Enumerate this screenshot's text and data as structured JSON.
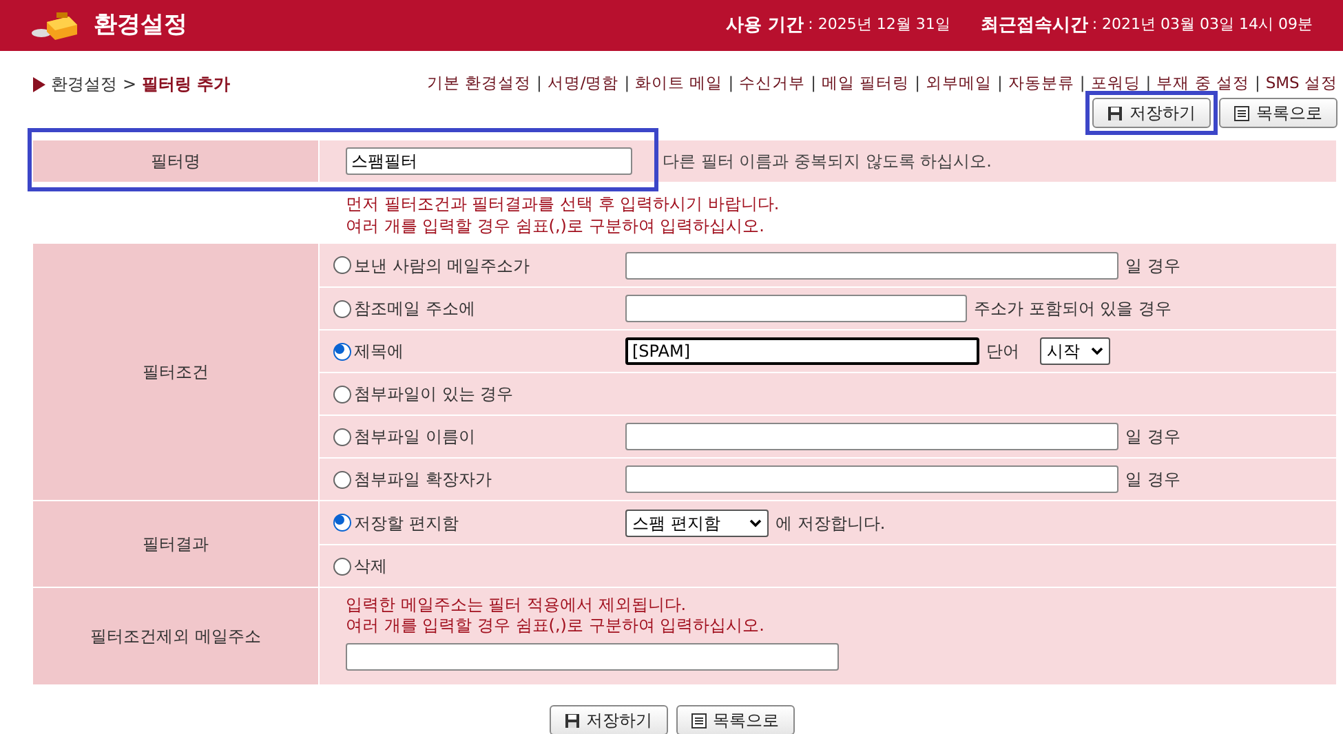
{
  "header": {
    "title": "환경설정",
    "period_label": "사용 기간",
    "period_value": ": 2025년 12월 31일",
    "login_label": "최근접속시간",
    "login_value": ": 2021년 03월 03일 14시 09분"
  },
  "breadcrumb": {
    "root": "환경설정",
    "separator": ">",
    "current": "필터링 추가"
  },
  "nav": [
    {
      "kind": "link",
      "label": "기본 환경설정"
    },
    {
      "kind": "separator",
      "label": "|"
    },
    {
      "kind": "link",
      "label": "서명/명함"
    },
    {
      "kind": "separator",
      "label": "|"
    },
    {
      "kind": "link",
      "label": "화이트 메일"
    },
    {
      "kind": "separator",
      "label": "|"
    },
    {
      "kind": "link",
      "label": "수신거부"
    },
    {
      "kind": "separator",
      "label": "|"
    },
    {
      "kind": "link",
      "label": "메일 필터링"
    },
    {
      "kind": "separator",
      "label": "|"
    },
    {
      "kind": "link",
      "label": "외부메일"
    },
    {
      "kind": "separator",
      "label": "|"
    },
    {
      "kind": "link",
      "label": "자동분류"
    },
    {
      "kind": "separator",
      "label": "|"
    },
    {
      "kind": "link",
      "label": "포워딩"
    },
    {
      "kind": "separator",
      "label": "|"
    },
    {
      "kind": "link",
      "label": "부재 중 설정"
    },
    {
      "kind": "separator",
      "label": "|"
    },
    {
      "kind": "link",
      "label": "SMS 설정"
    }
  ],
  "top_buttons": [
    {
      "label": "저장하기",
      "highlighted": true
    },
    {
      "label": "목록으로",
      "highlighted": false
    }
  ],
  "filter_name": {
    "label": "필터명",
    "value": "스팸필터",
    "hint": "다른 필터 이름과 중복되지 않도록 하십시오.",
    "highlighted": true
  },
  "notes": [
    "먼저 필터조건과 필터결과를 선택 후 입력하시기 바랍니다.",
    "여러 개를 입력할 경우 쉼표(,)로 구분하여 입력하십시오."
  ],
  "conditions": {
    "label": "필터조건",
    "options": [
      {
        "kind": "input",
        "label": "보낸 사람의 메일주소가",
        "selected": false,
        "suffix": "일 경우"
      },
      {
        "kind": "input_short",
        "label": "참조메일 주소에",
        "selected": false,
        "suffix": "주소가 포함되어 있을 경우"
      },
      {
        "kind": "input_select",
        "label": "제목에",
        "selected": true,
        "value": "[SPAM]",
        "suffix": "단어",
        "select": "시작"
      },
      {
        "kind": "none",
        "label": "첨부파일이 있는 경우",
        "selected": false
      },
      {
        "kind": "input",
        "label": "첨부파일 이름이",
        "selected": false,
        "suffix": "일 경우"
      },
      {
        "kind": "input",
        "label": "첨부파일 확장자가",
        "selected": false,
        "suffix": "일 경우"
      }
    ]
  },
  "result": {
    "label": "필터결과",
    "options": [
      {
        "kind": "select",
        "label": "저장할 편지함",
        "selected": true,
        "select": "스팸 편지함",
        "suffix": "에 저장합니다."
      },
      {
        "kind": "none",
        "label": "삭제",
        "selected": false
      }
    ]
  },
  "exclude": {
    "label": "필터조건제외 메일주소",
    "notes": [
      "입력한 메일주소는 필터 적용에서 제외됩니다.",
      "여러 개를 입력할 경우 쉼표(,)로 구분하여 입력하십시오."
    ]
  },
  "bottom_buttons": [
    {
      "label": "저장하기"
    },
    {
      "label": "목록으로"
    }
  ]
}
